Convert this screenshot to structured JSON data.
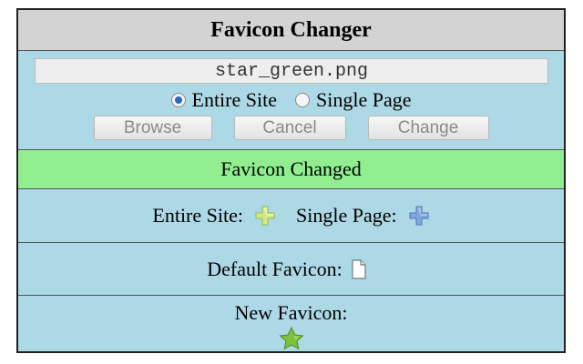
{
  "header": {
    "title": "Favicon Changer"
  },
  "file_input": {
    "value": "star_green.png"
  },
  "scope": {
    "options": [
      {
        "label": "Entire Site",
        "checked": true
      },
      {
        "label": "Single Page",
        "checked": false
      }
    ]
  },
  "buttons": {
    "browse": "Browse",
    "cancel": "Cancel",
    "change": "Change"
  },
  "status": {
    "message": "Favicon Changed"
  },
  "current": {
    "entire_site_label": "Entire Site:",
    "entire_site_icon": "plus-green-icon",
    "single_page_label": "Single Page:",
    "single_page_icon": "plus-blue-icon"
  },
  "default": {
    "label": "Default Favicon:",
    "icon": "blank-document-icon"
  },
  "new_favicon": {
    "label": "New Favicon:",
    "icon": "green-star-icon"
  },
  "colors": {
    "panel_bg": "#add8e6",
    "header_bg": "#d3d3d3",
    "status_bg": "#90ee90",
    "radio_accent": "#2a6ac0"
  }
}
